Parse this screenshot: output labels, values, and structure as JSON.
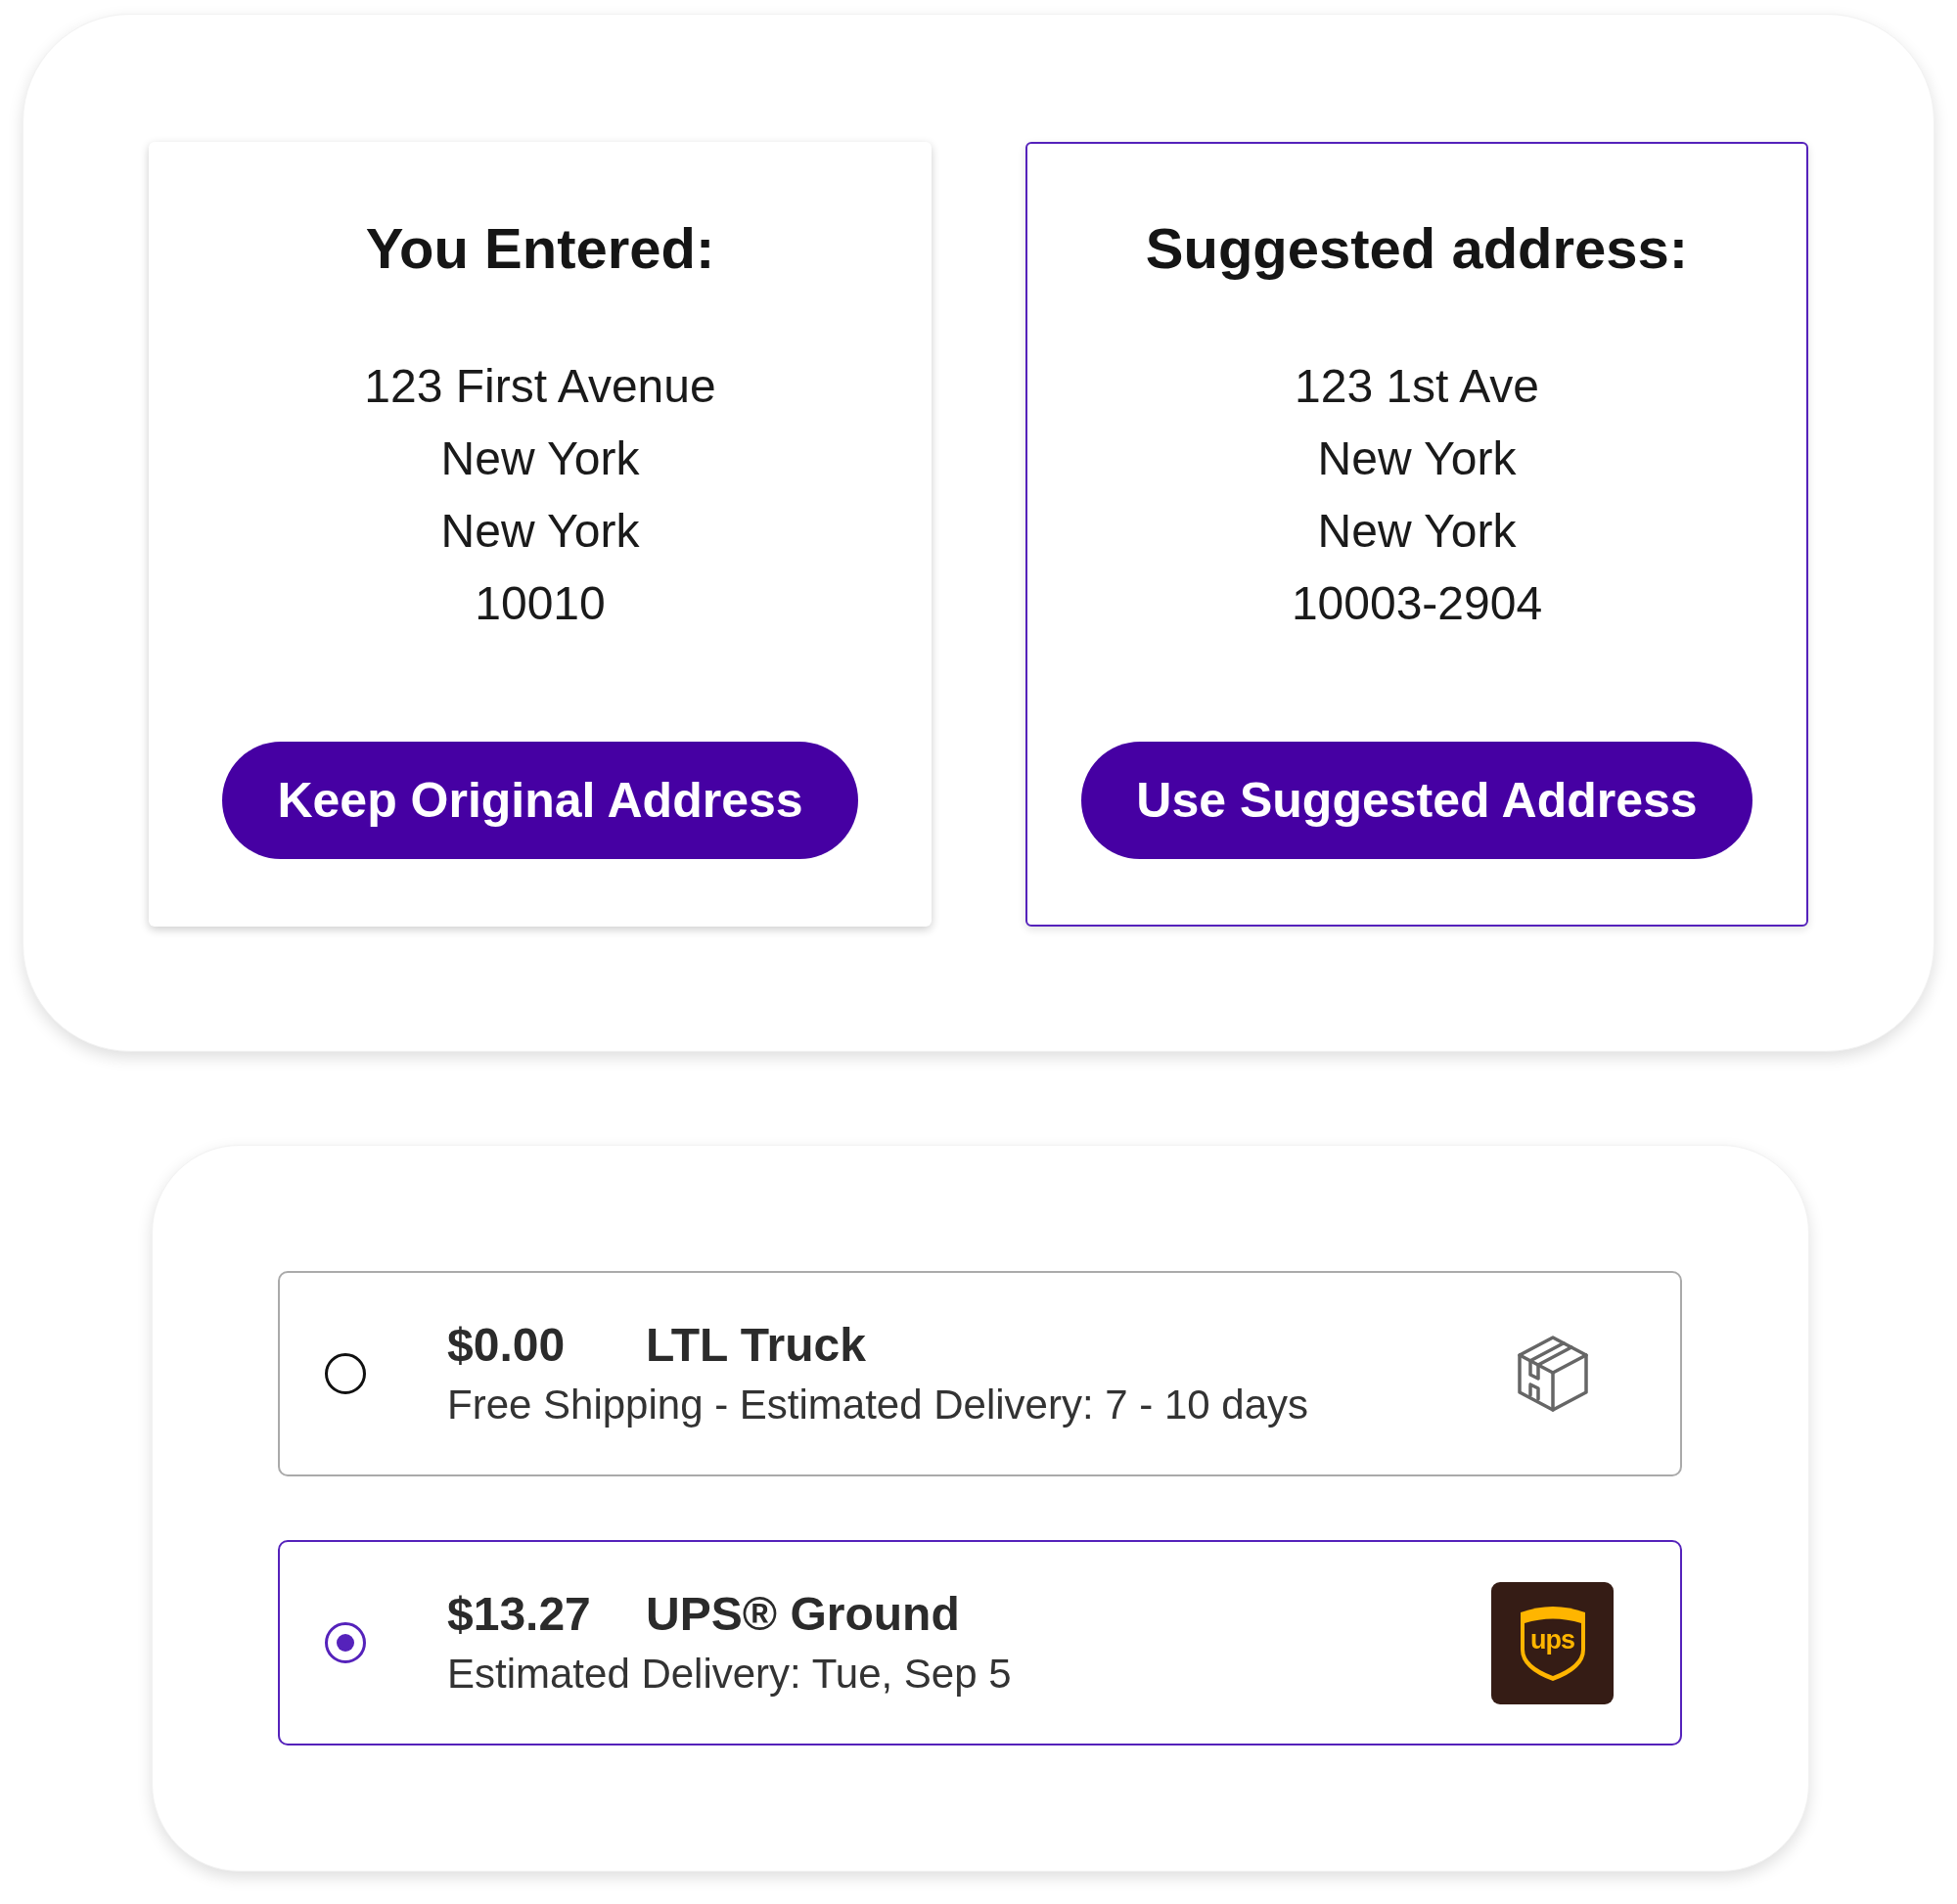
{
  "address_comparison": {
    "cards": [
      {
        "title": "You Entered:",
        "lines": [
          "123 First Avenue",
          "New York",
          "New York",
          "10010"
        ],
        "button": "Keep Original Address",
        "selected": false
      },
      {
        "title": "Suggested address:",
        "lines": [
          "123 1st Ave",
          "New York",
          "New York",
          "10003-2904"
        ],
        "button": "Use Suggested Address",
        "selected": true
      }
    ]
  },
  "shipping_options": [
    {
      "price": "$0.00",
      "name": "LTL Truck",
      "description": "Free Shipping - Estimated Delivery: 7 - 10 days",
      "selected": false,
      "carrier_icon": {
        "kind": "package"
      }
    },
    {
      "price": "$13.27",
      "name": "UPS® Ground",
      "description": "Estimated Delivery: Tue, Sep 5",
      "selected": true,
      "carrier_icon": {
        "kind": "logo",
        "text": "ups"
      }
    }
  ]
}
